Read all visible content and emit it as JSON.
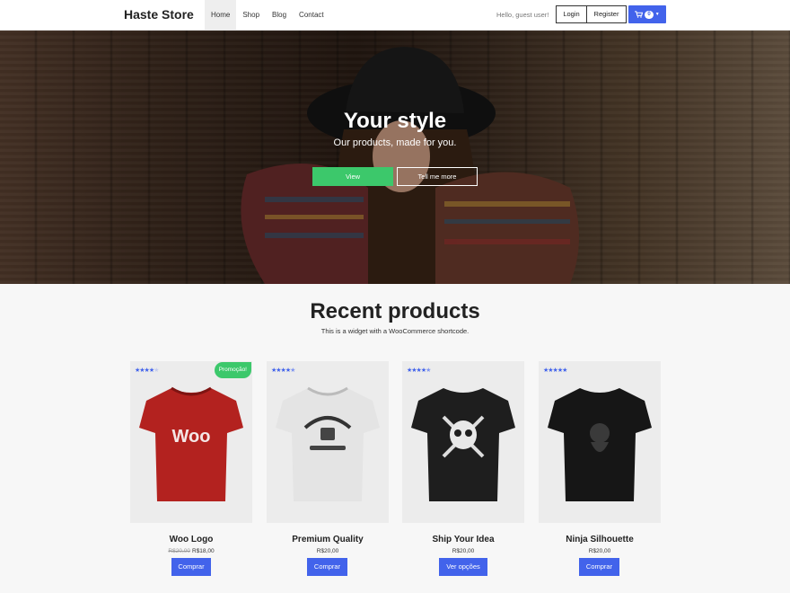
{
  "header": {
    "brand": "Haste Store",
    "nav": [
      "Home",
      "Shop",
      "Blog",
      "Contact"
    ],
    "greeting": "Hello, guest user!",
    "login_label": "Login",
    "register_label": "Register",
    "cart_count": "0",
    "accent_color": "#4263eb"
  },
  "hero": {
    "title": "Your style",
    "subtitle": "Our products, made for you.",
    "view_label": "View",
    "more_label": "Tell me more",
    "green_color": "#3cc86b"
  },
  "recent": {
    "title": "Recent products",
    "subtitle": "This is a widget with a WooCommerce shortcode."
  },
  "products": [
    {
      "name": "Woo Logo",
      "old_price": "R$20,00",
      "price": "R$18,00",
      "button": "Comprar",
      "sale": "Promoção!",
      "rating": 4,
      "shirt": "red"
    },
    {
      "name": "Premium Quality",
      "old_price": "",
      "price": "R$20,00",
      "button": "Comprar",
      "sale": "",
      "rating": 4.5,
      "shirt": "white"
    },
    {
      "name": "Ship Your Idea",
      "old_price": "",
      "price": "R$20,00",
      "button": "Ver opções",
      "sale": "",
      "rating": 4.5,
      "shirt": "black-skull"
    },
    {
      "name": "Ninja Silhouette",
      "old_price": "",
      "price": "R$20,00",
      "button": "Comprar",
      "sale": "",
      "rating": 5,
      "shirt": "black-ninja"
    }
  ]
}
